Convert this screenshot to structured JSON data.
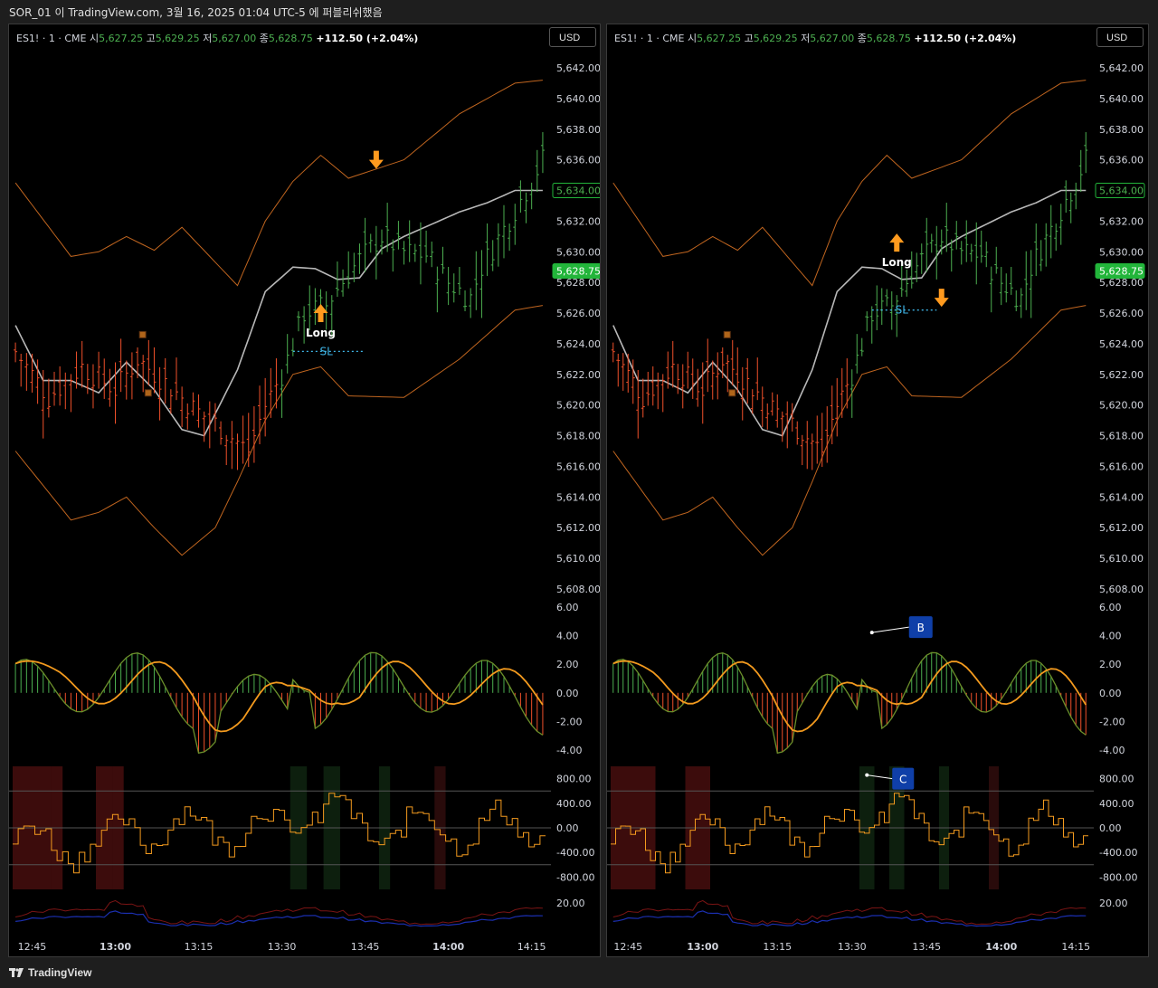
{
  "window": {
    "title": "SOR_01 이 TradingView.com, 3월 16, 2025 01:04 UTC-5 에 퍼블리쉬했음"
  },
  "footer": {
    "brand": "TradingView"
  },
  "colors": {
    "up": "#4caf50",
    "down": "#f0502a",
    "band": "#c0651f",
    "ma": "#b8b8b8",
    "signal": "#f39a1e",
    "sl": "#3fb6e8",
    "callout": "#0f3fa8",
    "price_tag": "#22b53a"
  },
  "panes": [
    {
      "id": "left",
      "legend": {
        "symbol": "ES1! · 1 · CME",
        "o_label": "시",
        "o": "5,627.25",
        "h_label": "고",
        "h": "5,629.25",
        "l_label": "저",
        "l": "5,627.00",
        "c_label": "종",
        "c": "5,628.75",
        "change": "+112.50 (+2.04%)"
      },
      "currency": "USD",
      "price_axis": [
        "5,642.00",
        "5,640.00",
        "5,638.00",
        "5,636.00",
        "5,634.00",
        "5,632.00",
        "5,630.00",
        "5,628.00",
        "5,626.00",
        "5,624.00",
        "5,622.00",
        "5,620.00",
        "5,618.00",
        "5,616.00",
        "5,614.00",
        "5,612.00",
        "5,610.00",
        "5,608.00"
      ],
      "last_price_tag": "5,628.75",
      "ma_tag": "5,634.00",
      "osc_axis": [
        "6.00",
        "4.00",
        "2.00",
        "0.00",
        "-2.00",
        "-4.00"
      ],
      "flow_axis": [
        "800.00",
        "400.00",
        "0.00",
        "-400.00",
        "-800.00"
      ],
      "vol_axis": [
        "20.00"
      ],
      "time_axis": [
        "12:45",
        "13:00",
        "13:15",
        "13:30",
        "13:45",
        "14:00",
        "14:15"
      ],
      "annotations": {
        "long": "Long",
        "sl": "SL"
      },
      "callouts": []
    },
    {
      "id": "right",
      "legend": {
        "symbol": "ES1! · 1 · CME",
        "o_label": "시",
        "o": "5,627.25",
        "h_label": "고",
        "h": "5,629.25",
        "l_label": "저",
        "l": "5,627.00",
        "c_label": "종",
        "c": "5,628.75",
        "change": "+112.50 (+2.04%)"
      },
      "currency": "USD",
      "price_axis": [
        "5,642.00",
        "5,640.00",
        "5,638.00",
        "5,636.00",
        "5,634.00",
        "5,632.00",
        "5,630.00",
        "5,628.00",
        "5,626.00",
        "5,624.00",
        "5,622.00",
        "5,620.00",
        "5,618.00",
        "5,616.00",
        "5,614.00",
        "5,612.00",
        "5,610.00",
        "5,608.00"
      ],
      "last_price_tag": "5,628.75",
      "ma_tag": "5,634.00",
      "osc_axis": [
        "6.00",
        "4.00",
        "2.00",
        "0.00",
        "-2.00",
        "-4.00"
      ],
      "flow_axis": [
        "800.00",
        "400.00",
        "0.00",
        "-400.00",
        "-800.00"
      ],
      "vol_axis": [
        "20.00"
      ],
      "time_axis": [
        "12:45",
        "13:00",
        "13:15",
        "13:30",
        "13:45",
        "14:00",
        "14:15"
      ],
      "annotations": {
        "long": "Long",
        "sl": "SL"
      },
      "callouts": [
        "B",
        "C"
      ]
    }
  ],
  "chart_data": [
    {
      "type": "bar",
      "symbol": "ES1!",
      "interval": "1",
      "exchange": "CME",
      "x_range": [
        "12:42",
        "14:18"
      ],
      "ylim": [
        5608,
        5642
      ],
      "close_path": [
        [
          0,
          5623.5
        ],
        [
          6,
          5620.5
        ],
        [
          12,
          5622.5
        ],
        [
          18,
          5621.0
        ],
        [
          22,
          5623.0
        ],
        [
          26,
          5621.8
        ],
        [
          32,
          5619.8
        ],
        [
          36,
          5618.8
        ],
        [
          42,
          5617.0
        ],
        [
          45,
          5620.0
        ],
        [
          48,
          5622.0
        ],
        [
          52,
          5626.0
        ],
        [
          56,
          5626.5
        ],
        [
          58,
          5627.6
        ],
        [
          62,
          5629.5
        ],
        [
          66,
          5631.0
        ],
        [
          70,
          5630.0
        ],
        [
          74,
          5629.8
        ],
        [
          78,
          5628.0
        ],
        [
          82,
          5627.0
        ],
        [
          84,
          5629.0
        ],
        [
          88,
          5631.5
        ],
        [
          92,
          5634.0
        ],
        [
          95,
          5636.0
        ]
      ],
      "ma_path": [
        [
          0,
          5625.2
        ],
        [
          5,
          5621.6
        ],
        [
          10,
          5621.6
        ],
        [
          15,
          5620.8
        ],
        [
          20,
          5622.8
        ],
        [
          25,
          5621.0
        ],
        [
          30,
          5618.4
        ],
        [
          34,
          5618.0
        ],
        [
          40,
          5622.3
        ],
        [
          45,
          5627.4
        ],
        [
          50,
          5629.0
        ],
        [
          54,
          5628.9
        ],
        [
          58,
          5628.2
        ],
        [
          62,
          5628.3
        ],
        [
          66,
          5630.2
        ],
        [
          70,
          5631.0
        ],
        [
          75,
          5631.8
        ],
        [
          80,
          5632.6
        ],
        [
          85,
          5633.2
        ],
        [
          90,
          5634.0
        ],
        [
          95,
          5634.0
        ]
      ],
      "band_upper_path": [
        [
          0,
          5634.5
        ],
        [
          10,
          5629.7
        ],
        [
          15,
          5630.0
        ],
        [
          20,
          5631.0
        ],
        [
          25,
          5630.1
        ],
        [
          30,
          5631.6
        ],
        [
          40,
          5627.8
        ],
        [
          45,
          5632.0
        ],
        [
          50,
          5634.6
        ],
        [
          55,
          5636.3
        ],
        [
          60,
          5634.8
        ],
        [
          70,
          5636.0
        ],
        [
          80,
          5639.0
        ],
        [
          90,
          5641.0
        ],
        [
          95,
          5641.2
        ]
      ],
      "band_lower_path": [
        [
          0,
          5617.0
        ],
        [
          10,
          5612.5
        ],
        [
          15,
          5613.0
        ],
        [
          20,
          5614.0
        ],
        [
          25,
          5612.0
        ],
        [
          30,
          5610.2
        ],
        [
          36,
          5612.0
        ],
        [
          40,
          5615.0
        ],
        [
          45,
          5619.0
        ],
        [
          50,
          5622.0
        ],
        [
          55,
          5622.5
        ],
        [
          60,
          5620.6
        ],
        [
          70,
          5620.5
        ],
        [
          80,
          5623.0
        ],
        [
          90,
          5626.2
        ],
        [
          95,
          5626.5
        ]
      ],
      "split_index": 48
    }
  ]
}
